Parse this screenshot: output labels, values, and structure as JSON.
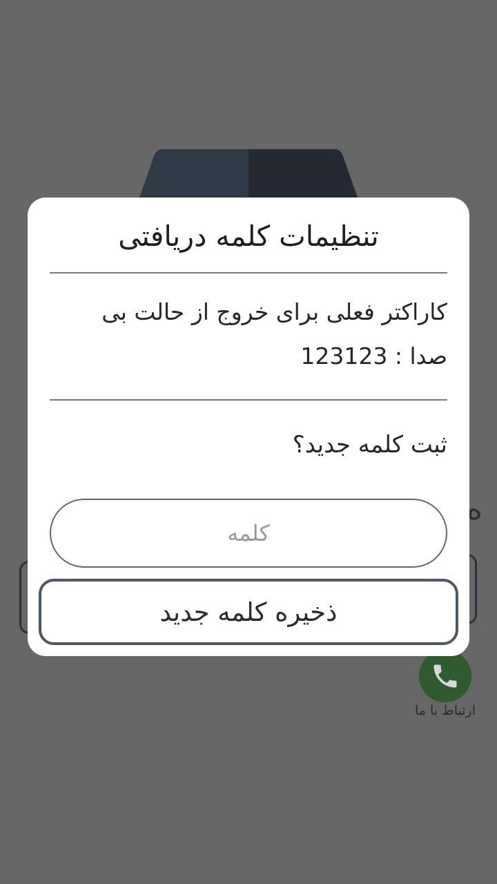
{
  "background": {
    "contact_label": "ارتباط با ما",
    "contact_icon": "phone-icon",
    "colors": {
      "overlay": "#666666",
      "header_shape_left": "#2f3a46",
      "header_shape_right": "#232a32",
      "contact_button": "#2f5a2d"
    }
  },
  "dialog": {
    "title": "تنظیمات کلمه دریافتی",
    "message": "کاراکتر فعلی برای خروج از حالت بی صدا : 123123",
    "prompt": "ثبت کلمه جدید؟",
    "word_input": {
      "placeholder": "کلمه",
      "value": ""
    },
    "save_label": "ذخیره کلمه جدید",
    "colors": {
      "surface": "#ffffff",
      "divider": "#6d7c88",
      "button_border": "#4a5866"
    }
  }
}
